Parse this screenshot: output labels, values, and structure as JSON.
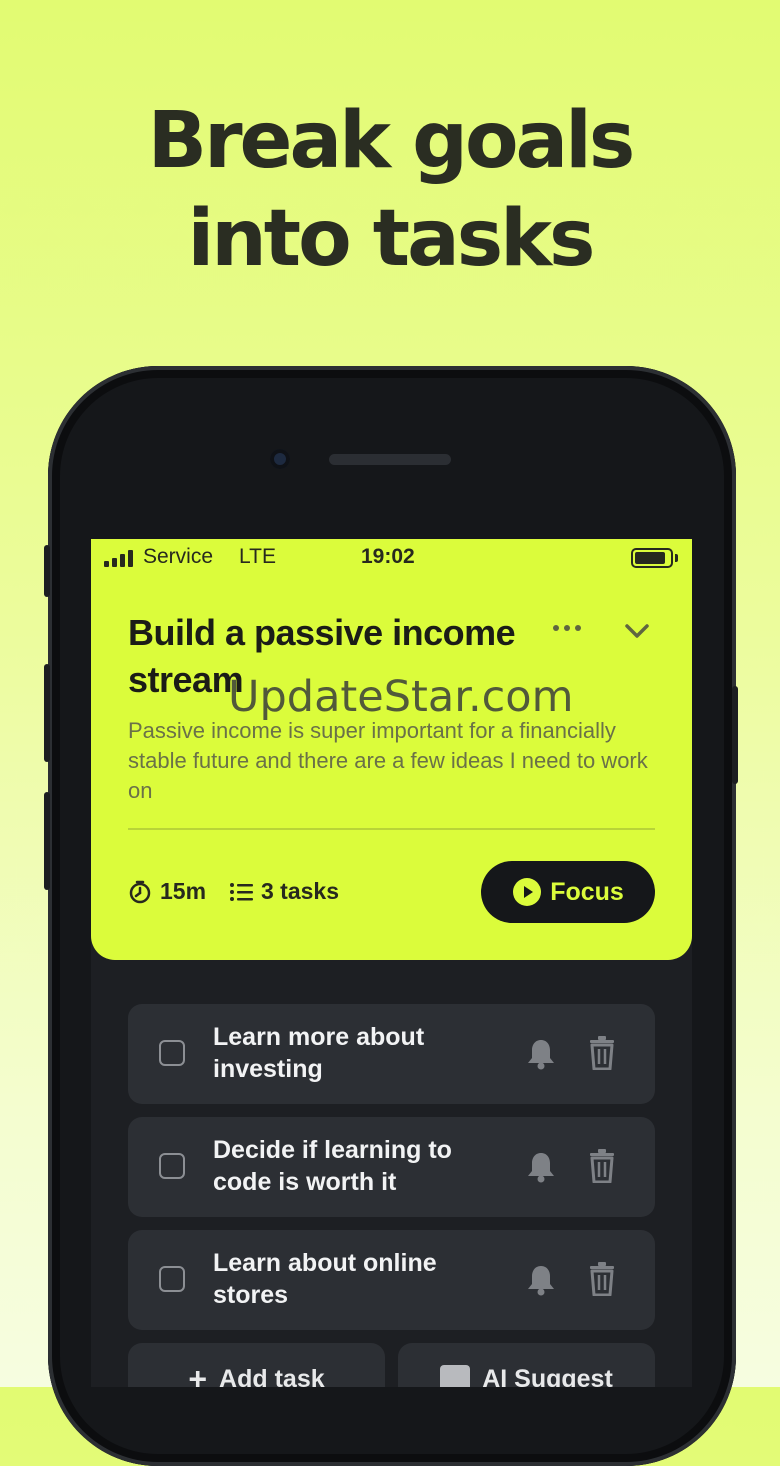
{
  "headline": {
    "line1": "Break goals",
    "line2": "into tasks"
  },
  "status_bar": {
    "carrier": "Service",
    "network": "LTE",
    "time": "19:02"
  },
  "goal": {
    "title": "Build a passive income stream",
    "description": "Passive income is super important for a financially stable future and there are a few ideas I need to work on",
    "duration": "15m",
    "task_count": "3 tasks",
    "focus_label": "Focus"
  },
  "tasks": [
    {
      "title": "Learn more about investing"
    },
    {
      "title": "Decide if learning to code is worth it"
    },
    {
      "title": "Learn about online stores"
    }
  ],
  "actions": {
    "add_task": "Add task",
    "ai_suggest": "AI Suggest"
  },
  "watermark": "UpdateStar.com",
  "colors": {
    "accent": "#dbfc3b",
    "background_top": "#e2fb72",
    "dark": "#15171a",
    "task_bg": "#2c2f34"
  }
}
